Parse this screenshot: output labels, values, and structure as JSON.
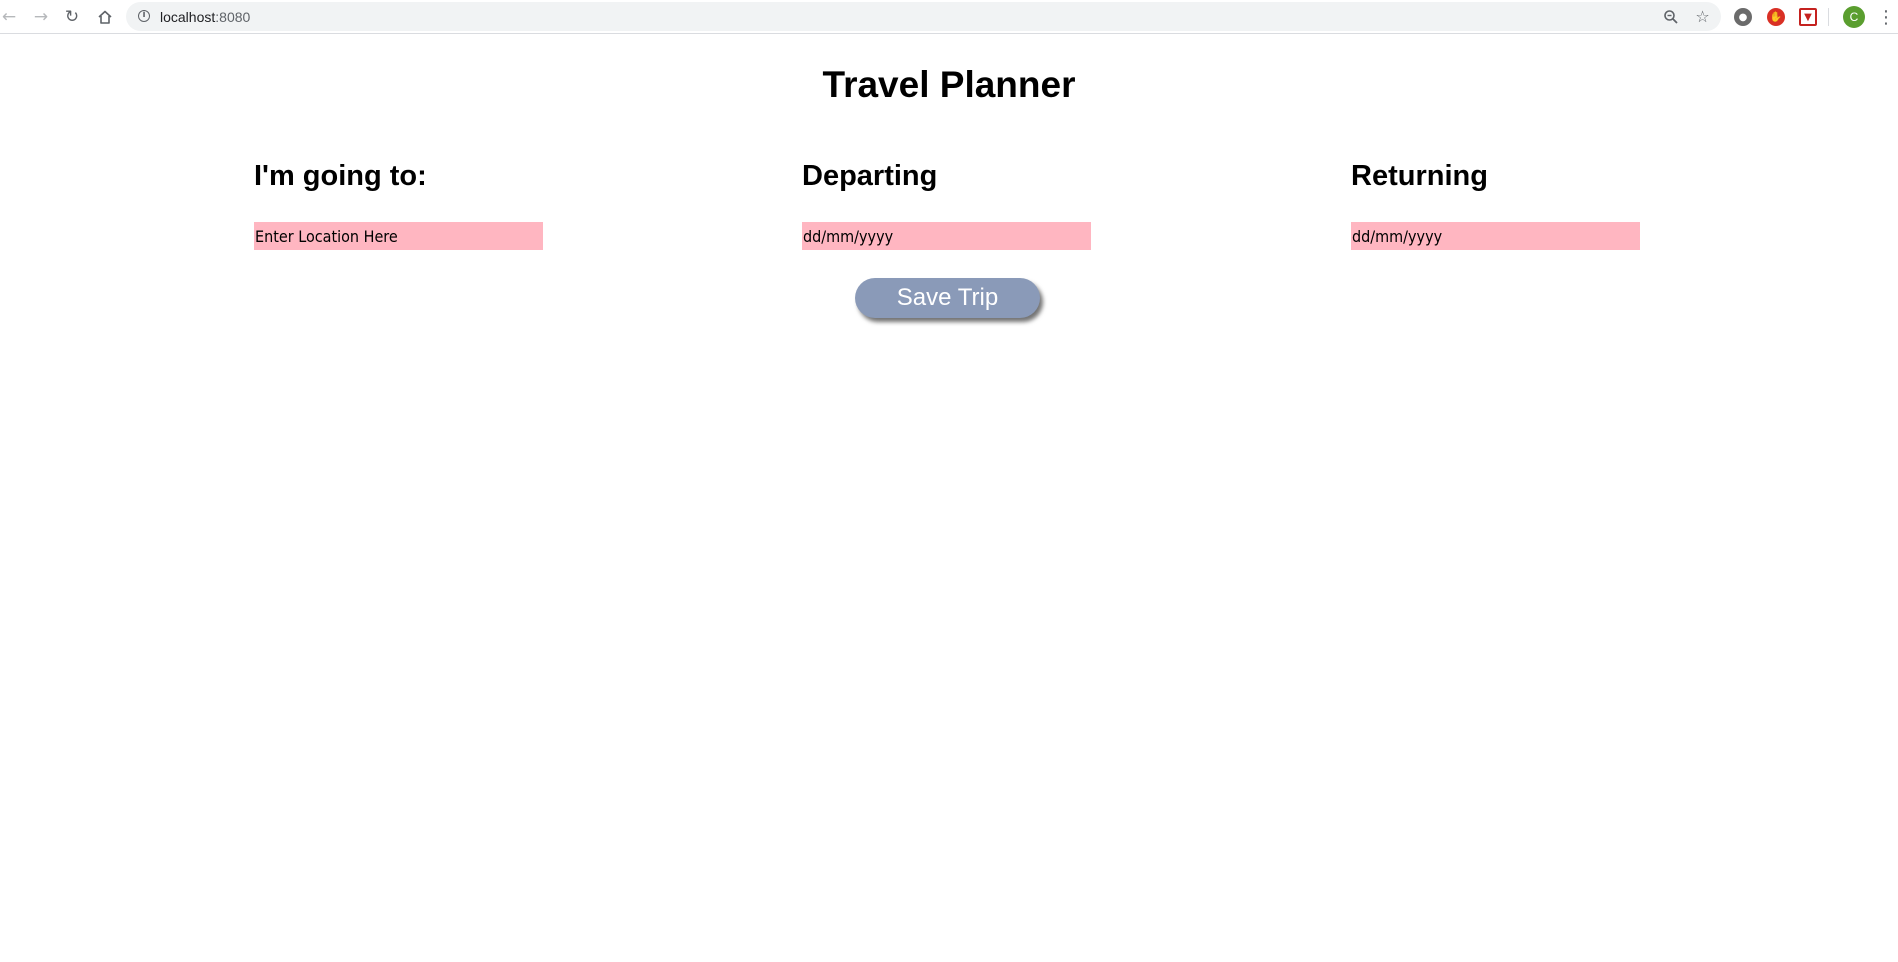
{
  "browser": {
    "url_host": "localhost",
    "url_port": ":8080",
    "back_icon": "back-arrow-icon",
    "forward_icon": "forward-arrow-icon",
    "reload_icon": "reload-icon",
    "home_icon": "home-icon",
    "profile_initial": "C"
  },
  "page": {
    "title": "Travel Planner",
    "destination": {
      "label": "I'm going to:",
      "placeholder": "Enter Location Here"
    },
    "departing": {
      "label": "Departing",
      "placeholder": "dd/mm/yyyy"
    },
    "returning": {
      "label": "Returning",
      "placeholder": "dd/mm/yyyy"
    },
    "save_button": "Save Trip"
  },
  "colors": {
    "input_background": "#ffb6c1",
    "button_background": "#8a9ab8",
    "button_text": "#ffffff"
  }
}
